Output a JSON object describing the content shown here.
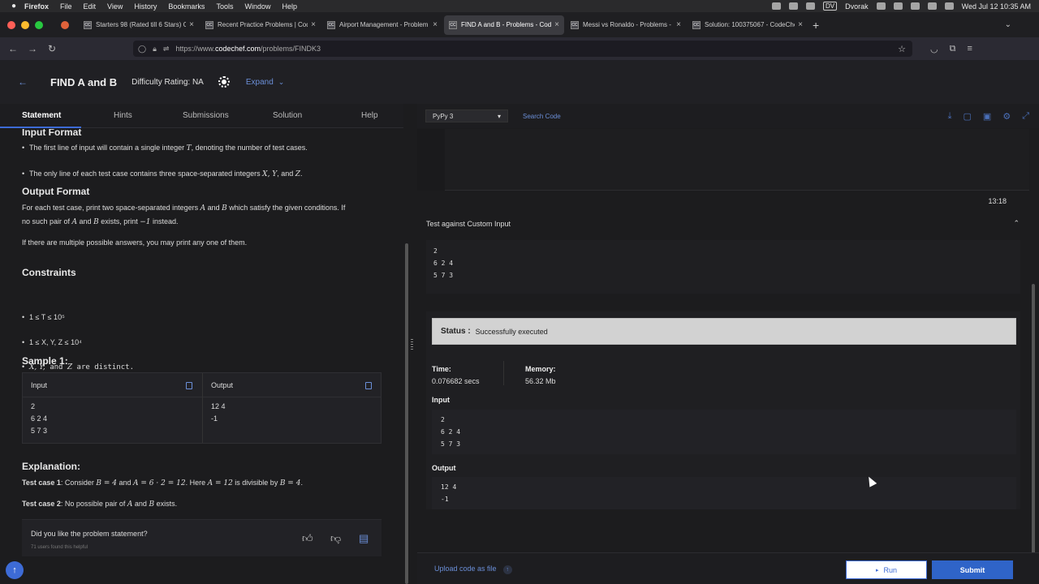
{
  "menubar": {
    "app": "Firefox",
    "items": [
      "File",
      "Edit",
      "View",
      "History",
      "Bookmarks",
      "Tools",
      "Window",
      "Help"
    ],
    "keyboard": "Dvorak",
    "dv": "DV",
    "datetime": "Wed Jul 12  10:35 AM"
  },
  "tabs": [
    {
      "title": "Starters 98 (Rated till 6 Stars) Co",
      "fav": "CC"
    },
    {
      "title": "Recent Practice Problems | Cod",
      "fav": "CC"
    },
    {
      "title": "Airport Management - Problem",
      "fav": "CC"
    },
    {
      "title": "FIND A and B - Problems - Code",
      "fav": "CC"
    },
    {
      "title": "Messi vs Ronaldo - Problems -",
      "fav": "CC"
    },
    {
      "title": "Solution: 100375067 - CodeChe",
      "fav": "CC"
    }
  ],
  "url": {
    "prefix": "https://www.",
    "domain": "codechef.com",
    "path": "/problems/FINDK3"
  },
  "header": {
    "title": "FIND A and B",
    "difficulty": "Difficulty Rating: NA",
    "expand": "Expand"
  },
  "left_tabs": [
    "Statement",
    "Hints",
    "Submissions",
    "Solution",
    "Help"
  ],
  "statement": {
    "input_format_h": "Input Format",
    "in1_a": "The first line of input will contain a single integer ",
    "in1_var": "T",
    "in1_b": ", denoting the number of test cases.",
    "in2_a": "The only line of each test case contains three space-separated integers ",
    "in2_vars": "X, Y",
    "in2_b": ", and ",
    "in2_z": "Z",
    "in2_c": ".",
    "output_format_h": "Output Format",
    "out1_a": "For each test case, print two space-separated integers ",
    "out1_A": "A",
    "out1_and": " and ",
    "out1_B": "B",
    "out1_b": " which satisfy the given conditions. If",
    "out2_a": "no such pair of ",
    "out2_A": "A",
    "out2_and": " and ",
    "out2_B": "B",
    "out2_b": " exists, print ",
    "out2_m": "−1",
    "out2_c": " instead.",
    "out3": "If there are multiple possible answers, you may print any one of them.",
    "constraints_h": "Constraints",
    "c1": "1 ≤ T ≤ 10⁵",
    "c2": "1 ≤ X, Y, Z ≤ 10⁴",
    "c3_vars": "X, Y,",
    "c3_and": " and ",
    "c3_z": "Z",
    "c3_rest": " are distinct.",
    "sample_h": "Sample 1:",
    "sample_input_h": "Input",
    "sample_output_h": "Output",
    "sample_input": "2\n6 2 4\n5 7 3",
    "sample_output": "12 4\n-1",
    "explanation_h": "Explanation:",
    "tc1_label": "Test case 1",
    "tc1_a": ": Consider ",
    "tc1_m1": "B = 4",
    "tc1_and": " and ",
    "tc1_m2": "A = 6 · 2 = 12",
    "tc1_b": ". Here ",
    "tc1_m3": "A = 12",
    "tc1_c": " is divisible by ",
    "tc1_m4": "B = 4",
    "tc1_d": ".",
    "tc2_label": "Test case 2",
    "tc2_a": ": No possible pair of ",
    "tc2_A": "A",
    "tc2_and": " and ",
    "tc2_B": "B",
    "tc2_b": " exists.",
    "feedback_q": "Did you like the problem statement?",
    "feedback_count": "71 users found this helpful"
  },
  "editor": {
    "language": "PyPy 3",
    "search": "Search Code",
    "timer": "13:18"
  },
  "custom_input": {
    "label": "Test against Custom Input",
    "value": "2\n6 2 4\n5 7 3"
  },
  "result": {
    "status_label": "Status :",
    "status_value": "Successfully executed",
    "time_label": "Time:",
    "time_value": "0.076682 secs",
    "memory_label": "Memory:",
    "memory_value": "56.32 Mb",
    "input_label": "Input",
    "input_value": "2\n6 2 4\n5 7 3",
    "output_label": "Output",
    "output_value": "12 4\n-1"
  },
  "footer": {
    "upload": "Upload code as file",
    "run": "Run",
    "submit": "Submit"
  },
  "colors": {
    "accent": "#3d6bd6",
    "status_bg": "#d2d2d2"
  }
}
